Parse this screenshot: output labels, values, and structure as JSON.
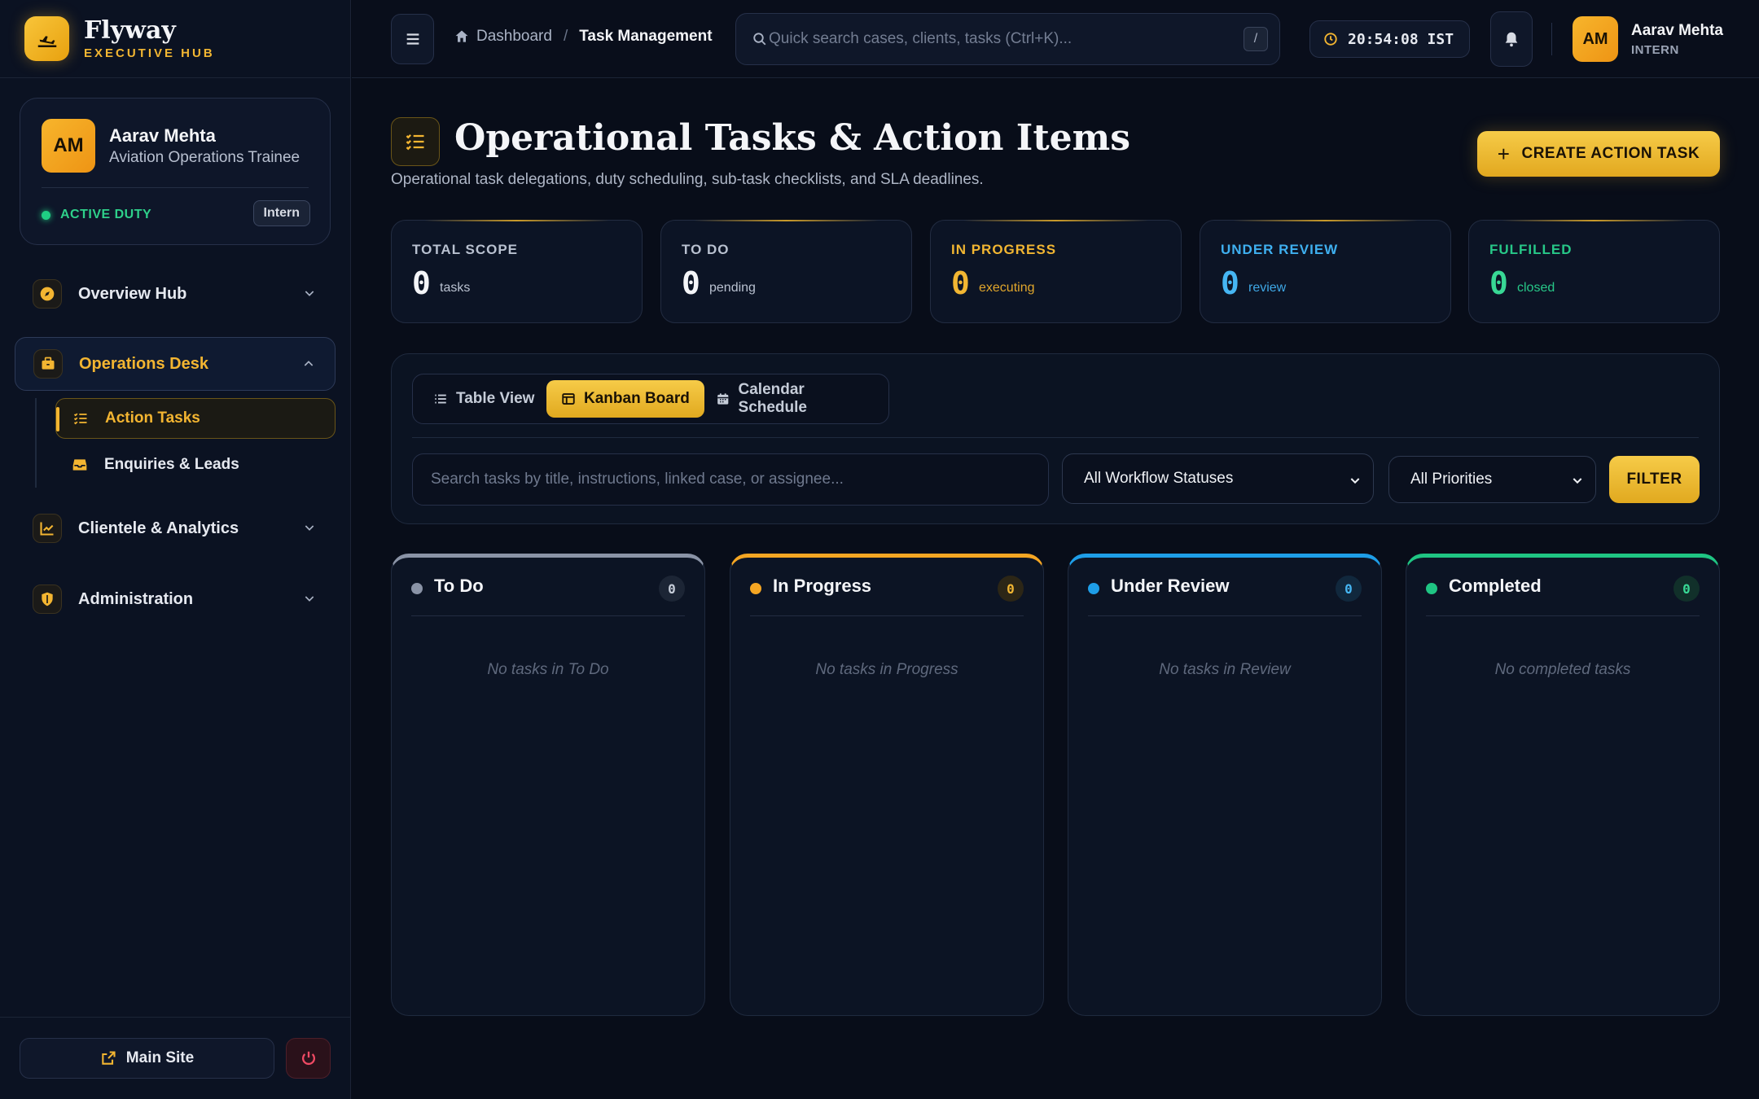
{
  "brand": {
    "name": "Flyway",
    "sub": "EXECUTIVE HUB"
  },
  "profile": {
    "initials": "AM",
    "name": "Aarav Mehta",
    "role": "Aviation Operations Trainee",
    "status": "ACTIVE DUTY",
    "badge": "Intern"
  },
  "nav": {
    "overview": "Overview Hub",
    "operations": "Operations Desk",
    "operations_sub": [
      {
        "label": "Action Tasks"
      },
      {
        "label": "Enquiries & Leads"
      }
    ],
    "clientele": "Clientele & Analytics",
    "admin": "Administration"
  },
  "footer": {
    "main_site": "Main Site"
  },
  "topbar": {
    "breadcrumb_home": "Dashboard",
    "breadcrumb_current": "Task Management",
    "search_placeholder": "Quick search cases, clients, tasks (Ctrl+K)...",
    "search_shortcut": "/",
    "clock": "20:54:08 IST",
    "user_initials": "AM",
    "user_name": "Aarav Mehta",
    "user_role": "INTERN"
  },
  "page": {
    "title": "Operational Tasks & Action Items",
    "subtitle": "Operational task delegations, duty scheduling, sub-task checklists, and SLA deadlines.",
    "create_label": "CREATE ACTION TASK"
  },
  "stats": [
    {
      "label": "TOTAL SCOPE",
      "value": "0",
      "unit": "tasks",
      "color": "#b9c1d0",
      "value_color": "#f4f5f8",
      "unit_color": "#b9c1d0"
    },
    {
      "label": "TO DO",
      "value": "0",
      "unit": "pending",
      "color": "#b9c1d0",
      "value_color": "#f4f5f8",
      "unit_color": "#b9c1d0"
    },
    {
      "label": "IN PROGRESS",
      "value": "0",
      "unit": "executing",
      "color": "#f2b632",
      "value_color": "#f2b632",
      "unit_color": "#e0a62c"
    },
    {
      "label": "UNDER REVIEW",
      "value": "0",
      "unit": "review",
      "color": "#3fb0f0",
      "value_color": "#46b6f3",
      "unit_color": "#3fa8e6"
    },
    {
      "label": "FULFILLED",
      "value": "0",
      "unit": "closed",
      "color": "#27c888",
      "value_color": "#38d895",
      "unit_color": "#27c888"
    }
  ],
  "views": {
    "table": "Table View",
    "kanban": "Kanban Board",
    "calendar": "Calendar Schedule"
  },
  "filters": {
    "search_placeholder": "Search tasks by title, instructions, linked case, or assignee...",
    "status_value": "All Workflow Statuses",
    "priority_value": "All Priorities",
    "filter_label": "FILTER"
  },
  "kanban": [
    {
      "title": "To Do",
      "count": "0",
      "empty": "No tasks in To Do",
      "accent": "#8a93a6",
      "count_bg": "#1c2535",
      "count_color": "#c5ccd8"
    },
    {
      "title": "In Progress",
      "count": "0",
      "empty": "No tasks in Progress",
      "accent": "#f5a623",
      "count_bg": "#2c2616",
      "count_color": "#f2b632"
    },
    {
      "title": "Under Review",
      "count": "0",
      "empty": "No tasks in Review",
      "accent": "#1e9ee8",
      "count_bg": "#11283d",
      "count_color": "#46b6f3"
    },
    {
      "title": "Completed",
      "count": "0",
      "empty": "No completed tasks",
      "accent": "#1fc583",
      "count_bg": "#11302a",
      "count_color": "#38d895"
    }
  ]
}
